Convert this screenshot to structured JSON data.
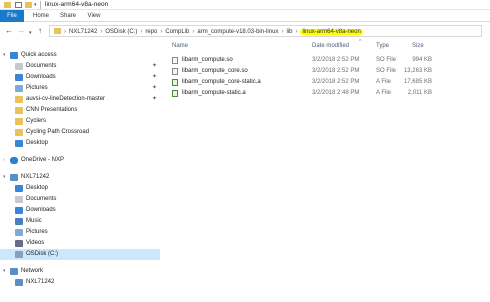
{
  "window": {
    "title": "linux-arm64-v8a-neon"
  },
  "ribbon": {
    "tabs": [
      "File",
      "Home",
      "Share",
      "View"
    ]
  },
  "address": {
    "crumbs": [
      "NXL71242",
      "OSDisk (C:)",
      "repo",
      "CompLib",
      "arm_compute-v18.03-bin-linux",
      "lib",
      "linux-arm64-v8a-neon"
    ]
  },
  "nav": {
    "quick_access": "Quick access",
    "quick_items": [
      "Documents",
      "Downloads",
      "Pictures",
      "auvsi-cv-lineDetection-master",
      "CNN Presentations",
      "Cyclers",
      "Cycling Path Crossroad",
      "Desktop"
    ],
    "onedrive": "OneDrive - NXP",
    "pc": "NXL71242",
    "pc_items": [
      "Desktop",
      "Documents",
      "Downloads",
      "Music",
      "Pictures",
      "Videos",
      "OSDisk (C:)"
    ],
    "network": "Network",
    "network_items": [
      "NXL71242"
    ]
  },
  "columns": {
    "name": "Name",
    "date": "Date modified",
    "type": "Type",
    "size": "Size"
  },
  "files": [
    {
      "name": "libarm_compute.so",
      "date": "3/2/2018 2:52 PM",
      "type": "SO File",
      "size": "994 KB"
    },
    {
      "name": "libarm_compute_core.so",
      "date": "3/2/2018 2:52 PM",
      "type": "SO File",
      "size": "13,263 KB"
    },
    {
      "name": "libarm_compute_core-static.a",
      "date": "3/2/2018 2:52 PM",
      "type": "A File",
      "size": "17,685 KB"
    },
    {
      "name": "libarm_compute-static.a",
      "date": "3/2/2018 2:48 PM",
      "type": "A File",
      "size": "2,011 KB"
    }
  ],
  "colors": {
    "file_tab": "#1979ca",
    "highlight": "#ffff00",
    "selection": "#cce8ff"
  }
}
